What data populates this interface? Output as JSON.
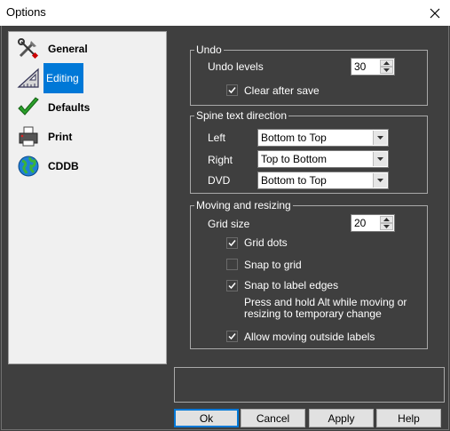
{
  "window": {
    "title": "Options"
  },
  "sidebar": {
    "items": [
      {
        "label": "General",
        "icon": "tools-icon"
      },
      {
        "label": "Editing",
        "icon": "ruler-icon"
      },
      {
        "label": "Defaults",
        "icon": "checkmark-icon"
      },
      {
        "label": "Print",
        "icon": "printer-icon"
      },
      {
        "label": "CDDB",
        "icon": "globe-icon"
      }
    ]
  },
  "undo": {
    "title": "Undo",
    "levels_label": "Undo levels",
    "levels_value": "30",
    "clear_label": "Clear after save",
    "clear_checked": true
  },
  "spine": {
    "title": "Spine text direction",
    "left_label": "Left",
    "left_value": "Bottom to Top",
    "right_label": "Right",
    "right_value": "Top to Bottom",
    "dvd_label": "DVD",
    "dvd_value": "Bottom to Top"
  },
  "moving": {
    "title": "Moving and resizing",
    "grid_size_label": "Grid size",
    "grid_size_value": "20",
    "grid_dots_label": "Grid dots",
    "grid_dots_checked": true,
    "snap_grid_label": "Snap to grid",
    "snap_grid_checked": false,
    "snap_edges_label": "Snap to label edges",
    "snap_edges_checked": true,
    "hint_line1": "Press and hold Alt while moving or",
    "hint_line2": "resizing to temporary change",
    "allow_outside_label": "Allow moving outside labels",
    "allow_outside_checked": true
  },
  "buttons": {
    "ok": "Ok",
    "cancel": "Cancel",
    "apply": "Apply",
    "help": "Help"
  },
  "colors": {
    "accent": "#0078d7",
    "background": "#3f3f3f",
    "sidebar": "#f0f0f0"
  }
}
